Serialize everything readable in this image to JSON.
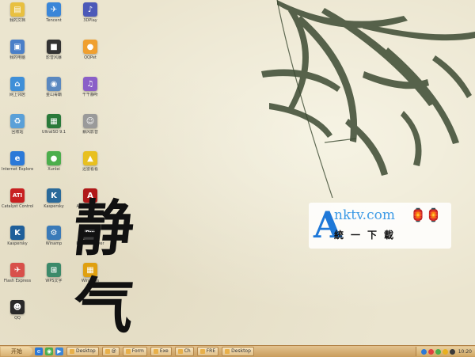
{
  "desktop": {
    "icons": [
      {
        "label": "我的文档",
        "glyph": "▤",
        "color": "#e8c040",
        "icon": "my-documents-icon"
      },
      {
        "label": "Tencent",
        "glyph": "✈",
        "color": "#3a86d8",
        "icon": "tencent-icon"
      },
      {
        "label": "3DPlay",
        "glyph": "♪",
        "color": "#4b59b8",
        "icon": "media-player-icon"
      },
      {
        "label": "我的电脑",
        "glyph": "▣",
        "color": "#4a7fc8",
        "icon": "my-computer-icon"
      },
      {
        "label": "影音风暴",
        "glyph": "■",
        "color": "#333333",
        "icon": "video-player-icon"
      },
      {
        "label": "QQPet",
        "glyph": "●",
        "color": "#f0a030",
        "icon": "qq-pet-icon"
      },
      {
        "label": "网上邻居",
        "glyph": "⌂",
        "color": "#3f8fd8",
        "icon": "network-icon"
      },
      {
        "label": "金山毒霸",
        "glyph": "◉",
        "color": "#5a88c0",
        "icon": "antivirus-icon"
      },
      {
        "label": "千千静听",
        "glyph": "♫",
        "color": "#8a5fc8",
        "icon": "music-player-icon"
      },
      {
        "label": "回收站",
        "glyph": "♻",
        "color": "#5aa0d8",
        "icon": "recycle-bin-icon"
      },
      {
        "label": "UltraISO 9.1",
        "glyph": "▦",
        "color": "#2a7a3a",
        "icon": "ultraiso-icon"
      },
      {
        "label": "暴风影音",
        "glyph": "☺",
        "color": "#9a9a9a",
        "icon": "storm-player-icon"
      },
      {
        "label": "Internet Explorer",
        "glyph": "e",
        "color": "#2b79d8",
        "icon": "internet-explorer-icon"
      },
      {
        "label": "Xunlei",
        "glyph": "●",
        "color": "#4cae4c",
        "icon": "xunlei-icon"
      },
      {
        "label": "迅雷看看",
        "glyph": "▲",
        "color": "#e8c020",
        "icon": "kankan-icon"
      },
      {
        "label": "Catalyst Control",
        "glyph": "ATI",
        "color": "#c82020",
        "icon": "ati-icon"
      },
      {
        "label": "Kaspersky",
        "glyph": "K",
        "color": "#2a6a9a",
        "icon": "kaspersky-icon"
      },
      {
        "label": "Adobe Reader",
        "glyph": "A",
        "color": "#b01818",
        "icon": "adobe-reader-icon"
      },
      {
        "label": "Kaspersky",
        "glyph": "K",
        "color": "#1f5f9a",
        "icon": "kaspersky-2-icon"
      },
      {
        "label": "Winamp",
        "glyph": "⚙",
        "color": "#3a7ab8",
        "icon": "winamp-icon"
      },
      {
        "label": "Dreamweaver",
        "glyph": "Dw",
        "color": "#3c3c3c",
        "icon": "dreamweaver-icon"
      },
      {
        "label": "Flash Express",
        "glyph": "✈",
        "color": "#d8504a",
        "icon": "flash-icon"
      },
      {
        "label": "WPS文字",
        "glyph": "⊞",
        "color": "#3c8a6a",
        "icon": "wps-icon"
      },
      {
        "label": "Windows",
        "glyph": "▦",
        "color": "#e0a010",
        "icon": "windows-media-icon"
      },
      {
        "label": "QQ",
        "glyph": "☻",
        "color": "#2a2a2a",
        "icon": "qq-icon"
      }
    ]
  },
  "calligraphy": {
    "line1": "静",
    "line2": "气"
  },
  "watermark": {
    "letter": "A",
    "domain": "nktv.com",
    "slogan": "統一下載",
    "ornament": "🏮🏮"
  },
  "taskbar": {
    "start_label": "开始",
    "quicklaunch": [
      {
        "glyph": "e",
        "color": "#2b79d8"
      },
      {
        "glyph": "◉",
        "color": "#4cae4c"
      },
      {
        "glyph": "▶",
        "color": "#3a86d8"
      }
    ],
    "tasks": [
      "Desktop",
      "@",
      "Form",
      "Exe",
      "Ch",
      "FRE",
      "Desktop"
    ],
    "tray_colors": [
      "#2b79d8",
      "#e04040",
      "#4cae4c",
      "#e8b020",
      "#3a3a3a"
    ],
    "clock": "10:20"
  },
  "colors": {
    "accent": "#1e78d8",
    "taskbar": "#d8b173"
  }
}
